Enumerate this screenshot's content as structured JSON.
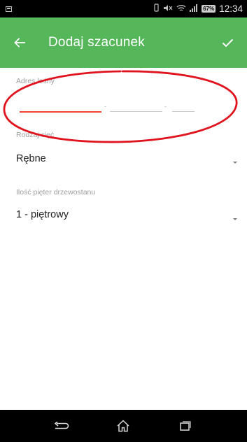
{
  "status_bar": {
    "battery": "67%",
    "time": "12:34",
    "icons": [
      "screenshot-icon",
      "vibrate-icon",
      "mute-icon",
      "wifi-icon",
      "signal-icon",
      "battery-icon"
    ]
  },
  "app_bar": {
    "title": "Dodaj szacunek",
    "back_icon": "arrow-left-icon",
    "confirm_icon": "check-icon",
    "color": "#56b65a"
  },
  "form": {
    "address_label": "Adres leśny",
    "address_separator": "-",
    "address_segments": [
      "",
      "",
      ""
    ],
    "cut_type": {
      "label": "Rodzaj cięć",
      "value": "Rębne"
    },
    "stand_layers": {
      "label": "Ilość pięter drzewostanu",
      "value": "1 - piętrowy"
    },
    "active_underline_color": "#f44336"
  },
  "annotation": {
    "color": "#e0141e",
    "shape": "ellipse"
  },
  "nav_bar": {
    "icons": [
      "back-icon",
      "home-icon",
      "recent-apps-icon"
    ]
  }
}
